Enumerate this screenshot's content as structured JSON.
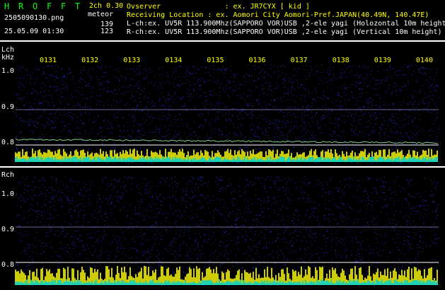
{
  "header": {
    "title_letters": [
      "H",
      "R",
      "O",
      "F",
      "F",
      "T"
    ],
    "version": "2ch 0.30",
    "meteor_label": "meteor",
    "filename": "2505090130.png",
    "datetime": "25.05.09 01:30",
    "count_l": "139",
    "count_r": "123",
    "observer": "Ovserver               : ex. JR7CYX [ kid ]",
    "location": "Receiving Location : ex. Aomori City Aomori-Pref.JAPAN(40.49N, 140.47E)",
    "lch_info": "L-ch:ex. UV5R 113.900Mhz(SAPPORO VOR)USB ,2-ele yagi (Holozontal 10m height)",
    "rch_info": "R-ch:ex. UV5R 113.900Mhz(SAPPORO VOR)USB ,2-ele yagi (Vertical 10m height)"
  },
  "lch": {
    "label": "Lch",
    "unit": "kHz",
    "ticks": [
      "1.0",
      "0.9",
      "0.8"
    ]
  },
  "rch": {
    "label": "Rch",
    "ticks": [
      "1.0",
      "0.9",
      "0.8"
    ]
  },
  "time_marks": [
    "0131",
    "0132",
    "0133",
    "0134",
    "0135",
    "0136",
    "0137",
    "0138",
    "0139",
    "0140"
  ],
  "colors": {
    "text": "#ffffff",
    "accent": "#ffff00",
    "title": "#00ff00",
    "level_bar": "#ffff00",
    "level_fill": "#00e0e0",
    "noise": "#3030ff",
    "carrier": "#b0b0ff"
  }
}
